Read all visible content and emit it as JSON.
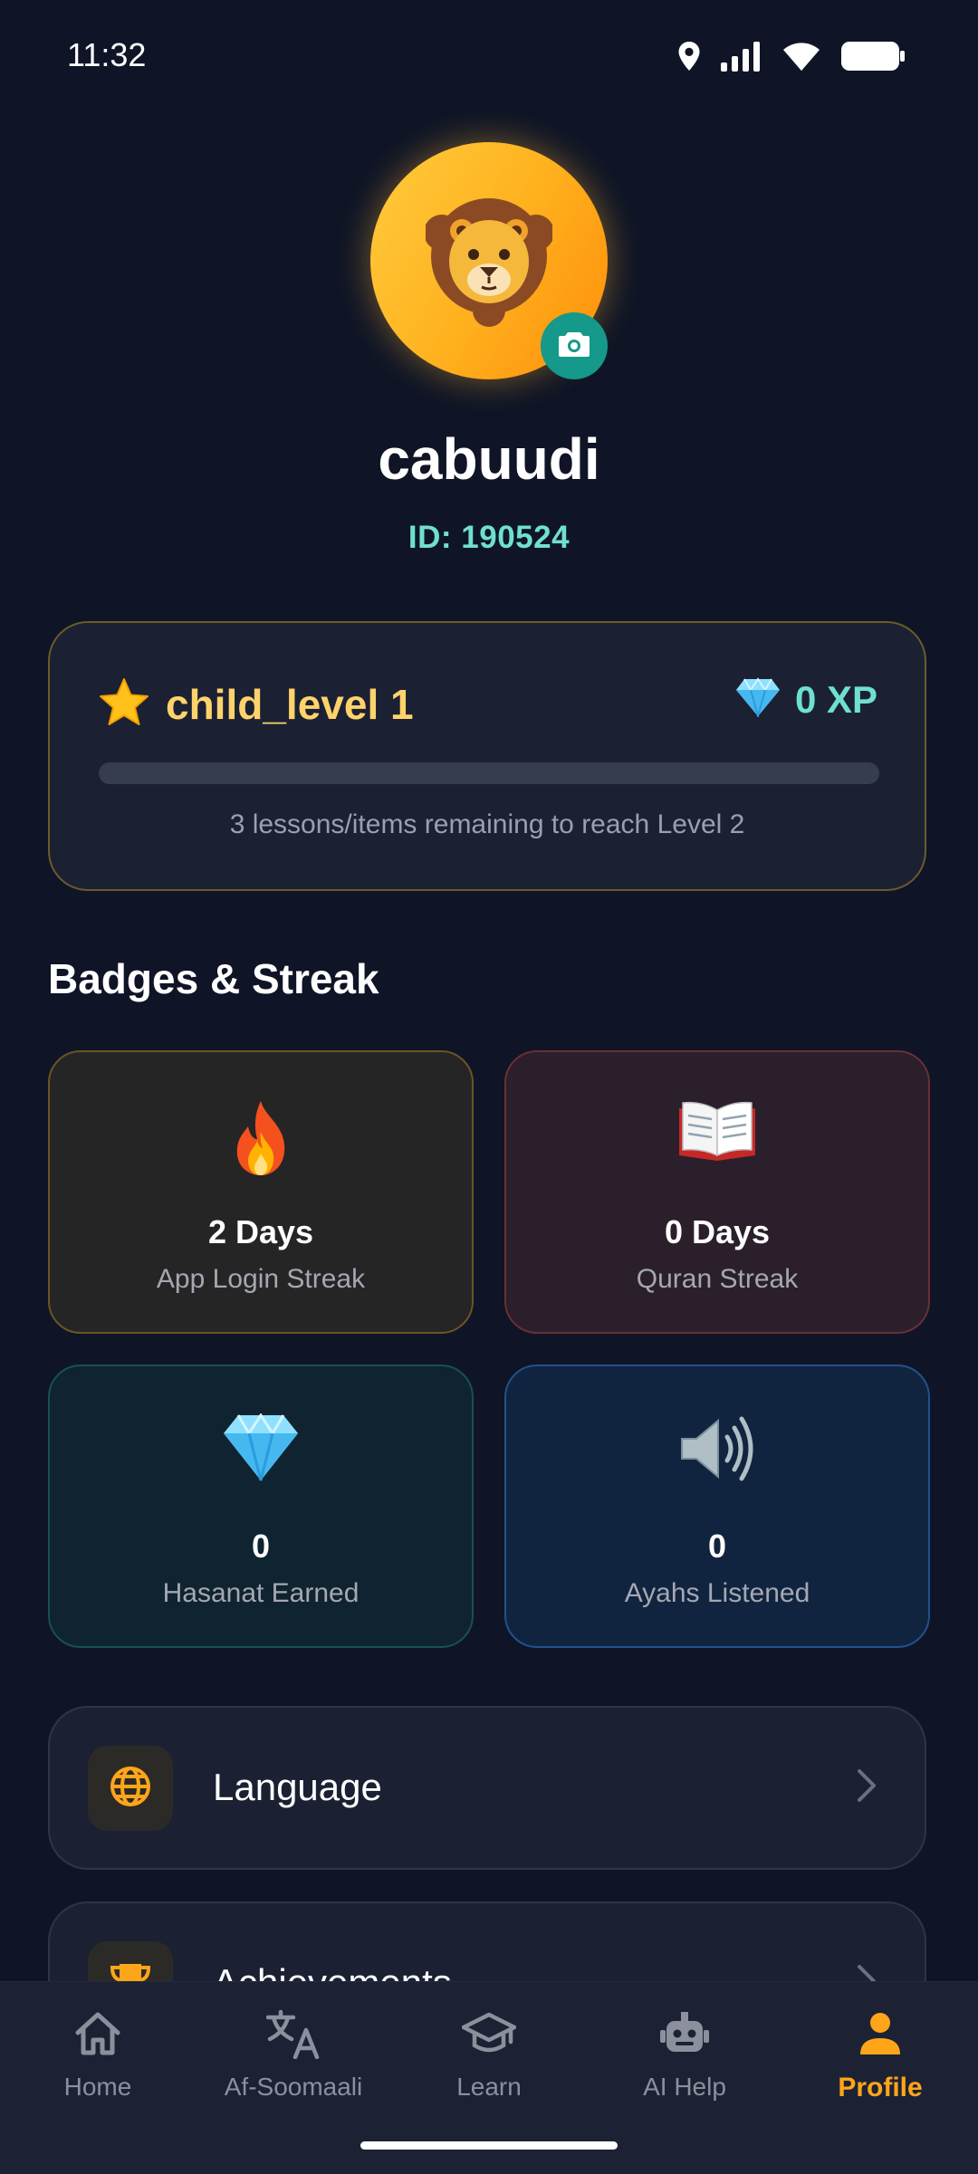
{
  "status_bar": {
    "time": "11:32",
    "icons": [
      "location-icon",
      "signal-icon",
      "wifi-icon",
      "battery-icon"
    ]
  },
  "profile": {
    "avatar_icon": "lion-icon",
    "camera_icon": "camera-icon",
    "username": "cabuudi",
    "id_text": "ID: 190524"
  },
  "level_card": {
    "star_icon": "star-icon",
    "level_label": "child_level 1",
    "xp_icon": "gem-icon",
    "xp_label": "0 XP",
    "progress": 0,
    "note": "3 lessons/items remaining to reach Level 2"
  },
  "badges": {
    "title": "Badges & Streak",
    "cards": [
      {
        "icon": "fire-icon",
        "value": "2 Days",
        "label": "App Login Streak"
      },
      {
        "icon": "book-icon",
        "value": "0 Days",
        "label": "Quran Streak"
      },
      {
        "icon": "gem-icon",
        "value": "0",
        "label": "Hasanat Earned"
      },
      {
        "icon": "speaker-icon",
        "value": "0",
        "label": "Ayahs Listened"
      }
    ]
  },
  "menu": [
    {
      "icon": "globe-icon",
      "label": "Language"
    },
    {
      "icon": "trophy-icon",
      "label": "Achievements"
    }
  ],
  "nav": {
    "items": [
      {
        "icon": "home-icon",
        "label": "Home"
      },
      {
        "icon": "translate-icon",
        "label": "Af-Soomaali"
      },
      {
        "icon": "graduation-cap-icon",
        "label": "Learn"
      },
      {
        "icon": "robot-icon",
        "label": "AI Help"
      },
      {
        "icon": "person-icon",
        "label": "Profile"
      }
    ],
    "active": "Profile"
  },
  "colors": {
    "background": "#0f1526",
    "card": "#1b2133",
    "accent_orange": "#ffa51a",
    "accent_teal": "#6fe0cf",
    "gold": "#ffd36b",
    "camera_button": "#14998a"
  }
}
